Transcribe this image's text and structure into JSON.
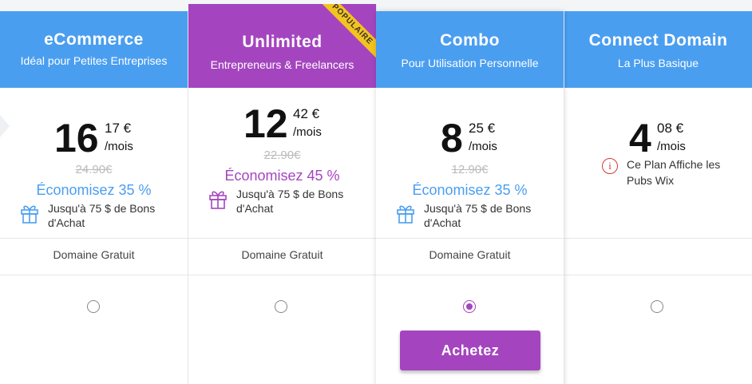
{
  "plans": [
    {
      "title": "eCommerce",
      "subtitle": "Idéal pour Petites Entreprises",
      "price_main": "16",
      "price_cents": "17 €",
      "per": "/mois",
      "old_price": "24.90€",
      "savings": "Économisez 35 %",
      "voucher": "Jusqu'à 75 $ de Bons d'Achat",
      "domain": "Domaine Gratuit",
      "selected": false
    },
    {
      "title": "Unlimited",
      "subtitle": "Entrepreneurs & Freelancers",
      "price_main": "12",
      "price_cents": "42 €",
      "per": "/mois",
      "old_price": "22.90€",
      "savings": "Économisez 45 %",
      "voucher": "Jusqu'à 75 $ de Bons d'Achat",
      "domain": "Domaine Gratuit",
      "badge": "POPULAIRE",
      "selected": false
    },
    {
      "title": "Combo",
      "subtitle": "Pour Utilisation Personnelle",
      "price_main": "8",
      "price_cents": "25 €",
      "per": "/mois",
      "old_price": "12.90€",
      "savings": "Économisez 35 %",
      "voucher": "Jusqu'à 75 $ de Bons d'Achat",
      "domain": "Domaine Gratuit",
      "selected": true,
      "buy_label": "Achetez"
    },
    {
      "title": "Connect Domain",
      "subtitle": "La Plus Basique",
      "price_main": "4",
      "price_cents": "08 €",
      "per": "/mois",
      "notice": "Ce Plan Affiche les Pubs Wix",
      "selected": false
    }
  ],
  "colors": {
    "blue": "#4a9ef0",
    "purple": "#a445bf",
    "ribbon": "#f3c31e"
  }
}
